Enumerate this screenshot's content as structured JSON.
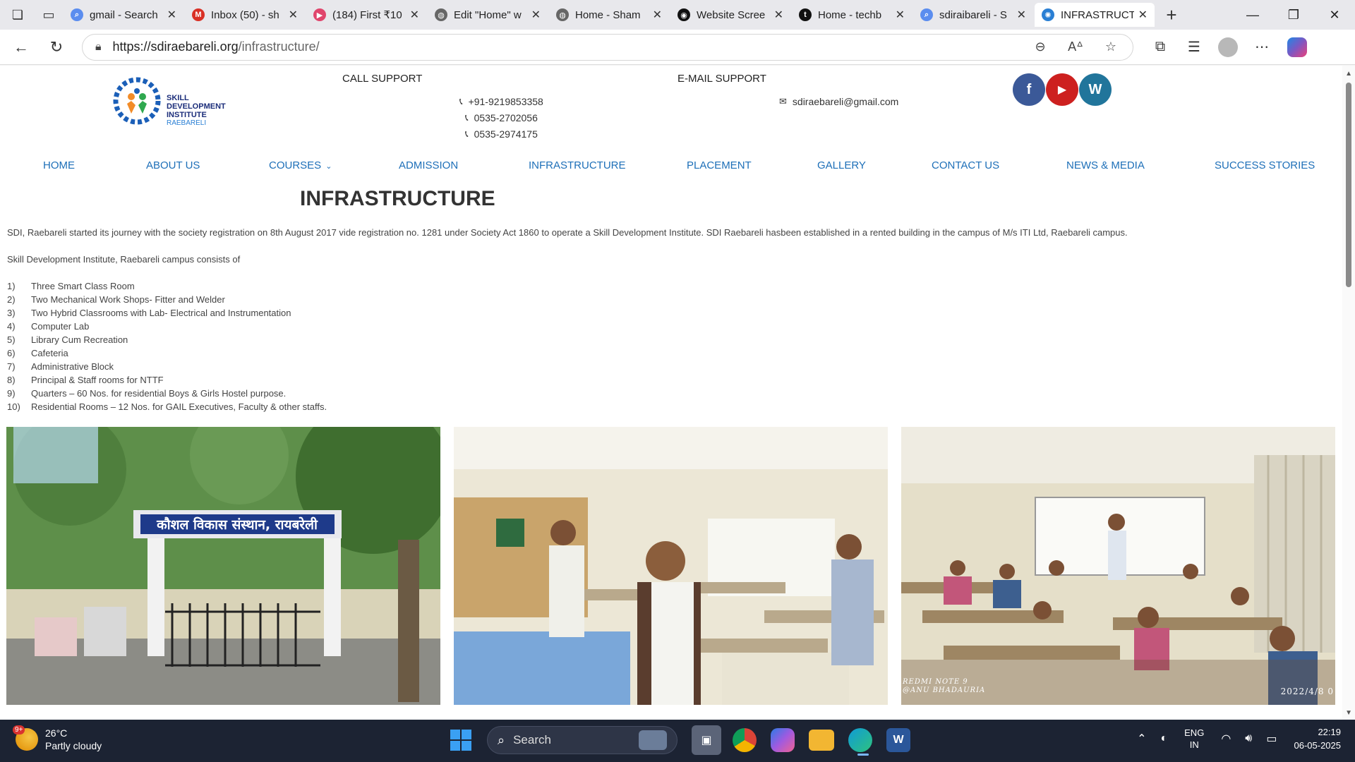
{
  "browser": {
    "tabs": [
      {
        "title": "gmail - Search",
        "favicon_color": "#5b8def",
        "favicon_glyph": "⌕"
      },
      {
        "title": "Inbox (50) - sh",
        "favicon_color": "#d93025",
        "favicon_glyph": "M"
      },
      {
        "title": "(184) First ₹10",
        "favicon_color": "#e0456c",
        "favicon_glyph": "▶"
      },
      {
        "title": "Edit \"Home\" w",
        "favicon_color": "#666666",
        "favicon_glyph": "◍"
      },
      {
        "title": "Home - Sham",
        "favicon_color": "#666666",
        "favicon_glyph": "◍"
      },
      {
        "title": "Website Scree",
        "favicon_color": "#111111",
        "favicon_glyph": "◉"
      },
      {
        "title": "Home - techb",
        "favicon_color": "#111111",
        "favicon_glyph": "t"
      },
      {
        "title": "sdiraibareli - S",
        "favicon_color": "#5b8def",
        "favicon_glyph": "⌕"
      },
      {
        "title": "INFRASTRUCT",
        "favicon_color": "#2a7fd4",
        "favicon_glyph": "✺"
      }
    ],
    "url_host": "https://sdiraebareli.org",
    "url_path": "/infrastructure/"
  },
  "site": {
    "logo": {
      "line1": "SKILL",
      "line2": "DEVELOPMENT",
      "line3": "INSTITUTE",
      "line4": "RAEBARELI"
    },
    "call_support_title": "CALL SUPPORT",
    "phones": [
      "+91-9219853358",
      "0535-2702056",
      "0535-2974175"
    ],
    "email_support_title": "E-MAIL SUPPORT",
    "email": "sdiraebareli@gmail.com",
    "social": [
      {
        "name": "facebook",
        "color": "#3b5998",
        "glyph": "f"
      },
      {
        "name": "youtube",
        "color": "#cd201f",
        "glyph": "▶"
      },
      {
        "name": "wordpress",
        "color": "#21759b",
        "glyph": "W"
      }
    ],
    "menu": [
      "HOME",
      "ABOUT US",
      "COURSES",
      "ADMISSION",
      "INFRASTRUCTURE",
      "PLACEMENT",
      "GALLERY",
      "CONTACT US",
      "NEWS & MEDIA",
      "SUCCESS STORIES"
    ],
    "page_title": "INFRASTRUCTURE",
    "intro": "SDI, Raebareli started its journey with the society registration on 8th  August 2017 vide registration no. 1281 under Society Act 1860 to operate a Skill Development Institute. SDI Raebareli hasbeen established in a rented building in the campus of M/s ITI Ltd, Raebareli campus.",
    "campus_intro": "Skill Development Institute, Raebareli campus consists of",
    "facilities": [
      {
        "num": "1)",
        "text": "Three Smart Class Room"
      },
      {
        "num": "2)",
        "text": "Two Mechanical Work Shops- Fitter and Welder"
      },
      {
        "num": "3)",
        "text": "Two Hybrid Classrooms with Lab- Electrical and Instrumentation"
      },
      {
        "num": "4)",
        "text": "Computer Lab"
      },
      {
        "num": "5)",
        "text": "Library Cum Recreation"
      },
      {
        "num": "6)",
        "text": "Cafeteria"
      },
      {
        "num": "7)",
        "text": "Administrative Block"
      },
      {
        "num": "8)",
        "text": "Principal & Staff rooms for NTTF"
      },
      {
        "num": "9)",
        "text": "Quarters – 60 Nos. for residential Boys & Girls Hostel purpose."
      },
      {
        "num": "10)",
        "text": "Residential Rooms – 12 Nos. for GAIL Executives, Faculty & other staffs."
      }
    ],
    "gate_sign": "कौशल विकास संस्थान, रायबरेली",
    "photo3_caption_left": "REDMI NOTE 9\n@ANU BHADAURIA",
    "photo3_caption_right": "2022/4/8 0"
  },
  "taskbar": {
    "weather_badge": "9+",
    "temperature": "26°C",
    "weather": "Partly cloudy",
    "search_label": "Search",
    "lang_line1": "ENG",
    "lang_line2": "IN",
    "time": "22:19",
    "date": "06-05-2025"
  }
}
